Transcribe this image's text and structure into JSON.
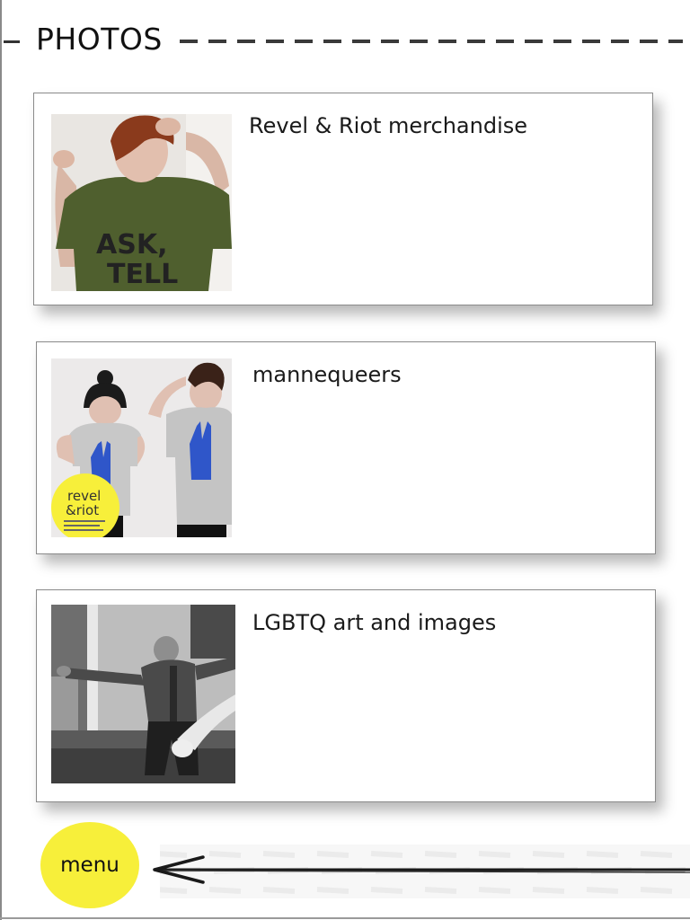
{
  "header": {
    "title": "PHOTOS"
  },
  "albums": [
    {
      "label": "Revel & Riot merchandise"
    },
    {
      "label": "mannequeers",
      "badge_line1": "revel",
      "badge_line2": "&riot"
    },
    {
      "label": "LGBTQ art and images"
    }
  ],
  "menu": {
    "label": "menu"
  },
  "colors": {
    "accent_yellow": "#f7ef3a",
    "shirt_green": "#4a5a2a",
    "print_blue": "#2f56c9"
  }
}
